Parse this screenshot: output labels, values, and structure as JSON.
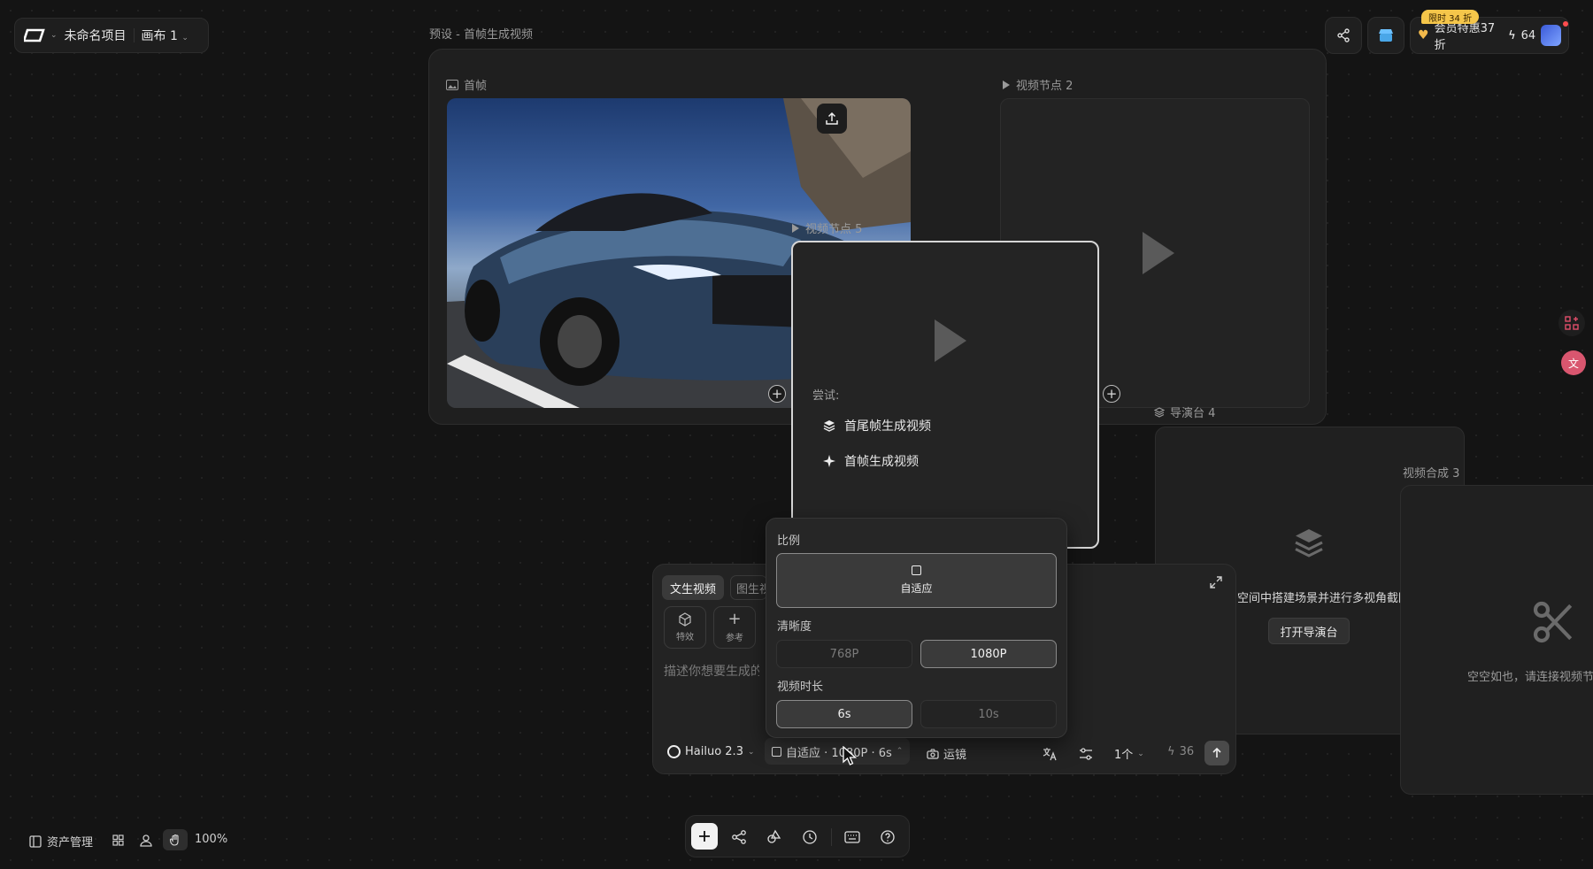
{
  "header": {
    "project_name": "未命名项目",
    "canvas_name": "画布 1",
    "preset_title": "预设 - 首帧生成视频"
  },
  "top_right": {
    "promo_badge": "限时 34 折",
    "member_offer": "会员特惠37折",
    "credits": "64"
  },
  "nodes": {
    "first_frame_label": "首帧",
    "video_node_2_label": "视频节点 2",
    "video_node_5_label": "视频节点 5",
    "director_label": "导演台 4",
    "composite_label": "视频合成 3"
  },
  "video5_card": {
    "try_label": "尝试:",
    "items": [
      "首尾帧生成视频",
      "首帧生成视频"
    ]
  },
  "director": {
    "description_partial": "空间中搭建场景并进行多视角截图",
    "open_button": "打开导演台"
  },
  "composite": {
    "empty_text": "空空如也，请连接视频节点"
  },
  "prompt_panel": {
    "tabs": [
      "文生视频",
      "图生视频"
    ],
    "tools": [
      "特效",
      "参考"
    ],
    "placeholder": "描述你想要生成的画面",
    "model": "Hailuo 2.3",
    "settings_summary": "自适应 · 1080P · 6s",
    "camera_label": "运镜",
    "count": "1个",
    "cost": "36"
  },
  "settings_popover": {
    "ratio_label": "比例",
    "ratio_selected": "自适应",
    "resolution_label": "清晰度",
    "resolutions": [
      "768P",
      "1080P"
    ],
    "selected_resolution": "1080P",
    "duration_label": "视频时长",
    "durations": [
      "6s",
      "10s"
    ],
    "selected_duration": "6s"
  },
  "bottom_left": {
    "assets_label": "资产管理",
    "zoom": "100%"
  },
  "icons": [
    "share-icon",
    "store-icon",
    "play-icon",
    "plus-icon",
    "layers-icon",
    "sparkle-icon",
    "scissors-icon",
    "expand-icon",
    "translate-icon",
    "sliders-icon",
    "send-icon",
    "history-icon",
    "keyboard-icon",
    "help-icon"
  ]
}
